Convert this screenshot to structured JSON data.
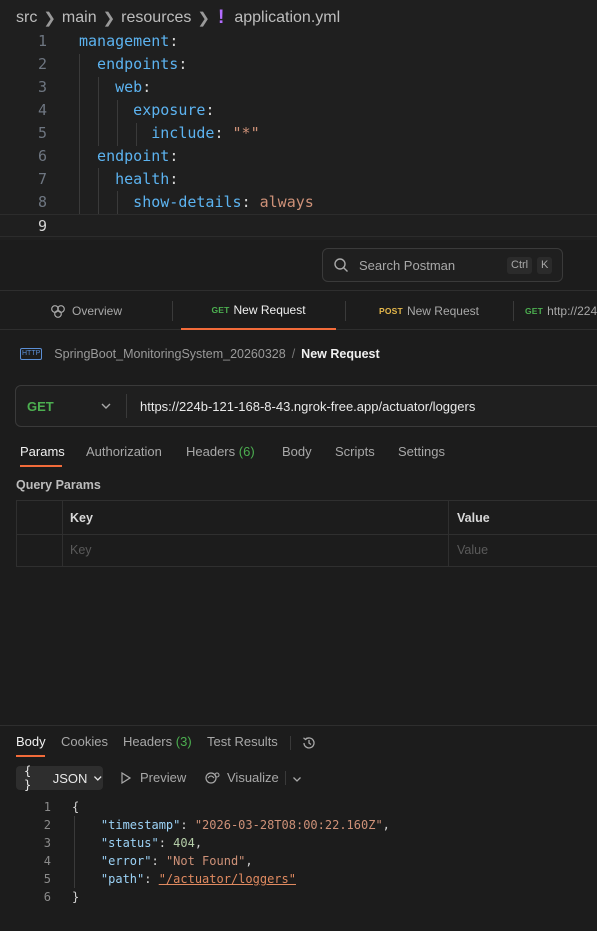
{
  "editor": {
    "breadcrumb": [
      "src",
      "main",
      "resources",
      "application.yml"
    ],
    "lines": [
      {
        "n": "1",
        "parts": [
          {
            "t": "management",
            "c": "k"
          },
          {
            "t": ":",
            "c": "p"
          }
        ]
      },
      {
        "n": "2",
        "parts": [
          {
            "t": "  endpoints",
            "c": "k"
          },
          {
            "t": ":",
            "c": "p"
          }
        ]
      },
      {
        "n": "3",
        "parts": [
          {
            "t": "    web",
            "c": "k"
          },
          {
            "t": ":",
            "c": "p"
          }
        ]
      },
      {
        "n": "4",
        "parts": [
          {
            "t": "      exposure",
            "c": "k"
          },
          {
            "t": ":",
            "c": "p"
          }
        ]
      },
      {
        "n": "5",
        "parts": [
          {
            "t": "        include",
            "c": "k"
          },
          {
            "t": ": ",
            "c": "p"
          },
          {
            "t": "\"*\"",
            "c": "s"
          }
        ]
      },
      {
        "n": "6",
        "parts": [
          {
            "t": "  endpoint",
            "c": "k"
          },
          {
            "t": ":",
            "c": "p"
          }
        ]
      },
      {
        "n": "7",
        "parts": [
          {
            "t": "    health",
            "c": "k"
          },
          {
            "t": ":",
            "c": "p"
          }
        ]
      },
      {
        "n": "8",
        "parts": [
          {
            "t": "      show-details",
            "c": "k"
          },
          {
            "t": ": ",
            "c": "p"
          },
          {
            "t": "always",
            "c": "s"
          }
        ]
      },
      {
        "n": "9",
        "parts": []
      }
    ]
  },
  "postman": {
    "search_placeholder": "Search Postman",
    "search_shortcut": [
      "Ctrl",
      "K"
    ],
    "tabs": [
      {
        "method": "",
        "label": "Overview"
      },
      {
        "method": "GET",
        "label": "New Request"
      },
      {
        "method": "POST",
        "label": "New Request"
      },
      {
        "method": "GET",
        "label": "http://224"
      }
    ],
    "breadcrumb": {
      "icon_text": "HTTP",
      "collection": "SpringBoot_MonitoringSystem_20260328",
      "separator": "/",
      "request": "New Request"
    },
    "request": {
      "method": "GET",
      "url": "https://224b-121-168-8-43.ngrok-free.app/actuator/loggers"
    },
    "subtabs": {
      "params": "Params",
      "authorization": "Authorization",
      "headers": "Headers",
      "headers_count": "(6)",
      "body": "Body",
      "scripts": "Scripts",
      "settings": "Settings"
    },
    "query_params": {
      "label": "Query Params",
      "key_header": "Key",
      "value_header": "Value",
      "key_placeholder": "Key",
      "value_placeholder": "Value"
    }
  },
  "response": {
    "tabs": {
      "body": "Body",
      "cookies": "Cookies",
      "headers": "Headers",
      "headers_count": "(3)",
      "test_results": "Test Results"
    },
    "format": "JSON",
    "format_icon": "{ }",
    "preview": "Preview",
    "visualize": "Visualize",
    "lines": [
      {
        "n": "1",
        "parts": [
          {
            "t": "{",
            "c": "p"
          }
        ]
      },
      {
        "n": "2",
        "parts": [
          {
            "t": "    \"timestamp\"",
            "c": "jk"
          },
          {
            "t": ": ",
            "c": "p"
          },
          {
            "t": "\"2026-03-28T08:00:22.160Z\"",
            "c": "js"
          },
          {
            "t": ",",
            "c": "p"
          }
        ]
      },
      {
        "n": "3",
        "parts": [
          {
            "t": "    \"status\"",
            "c": "jk"
          },
          {
            "t": ": ",
            "c": "p"
          },
          {
            "t": "404",
            "c": "jn"
          },
          {
            "t": ",",
            "c": "p"
          }
        ]
      },
      {
        "n": "4",
        "parts": [
          {
            "t": "    \"error\"",
            "c": "jk"
          },
          {
            "t": ": ",
            "c": "p"
          },
          {
            "t": "\"Not Found\"",
            "c": "js"
          },
          {
            "t": ",",
            "c": "p"
          }
        ]
      },
      {
        "n": "5",
        "parts": [
          {
            "t": "    \"path\"",
            "c": "jk"
          },
          {
            "t": ": ",
            "c": "p"
          },
          {
            "t": "\"/actuator/loggers\"",
            "c": "jl"
          }
        ]
      },
      {
        "n": "6",
        "parts": [
          {
            "t": "}",
            "c": "p"
          }
        ]
      }
    ]
  },
  "colors": {
    "accent": "#f26b3a",
    "get": "#4caf50",
    "post": "#e5b84b",
    "yaml_key": "#5cb3f0",
    "yaml_string": "#ce9178"
  }
}
